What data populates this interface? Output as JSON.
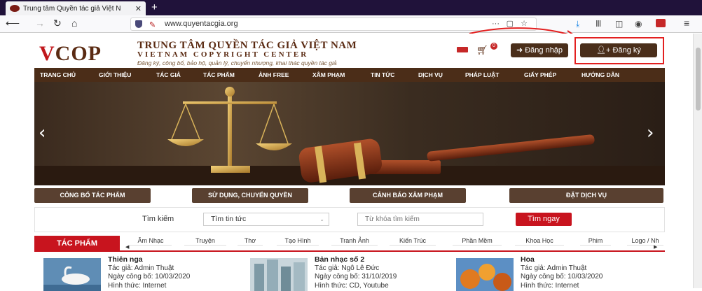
{
  "browser": {
    "tab_title": "Trung tâm Quyền tác giả Việt N",
    "url": "www.quyentacgia.org"
  },
  "header": {
    "logo_red": "V",
    "logo_rest": "COP",
    "org_name_vi": "TRUNG TÂM QUYỀN TÁC GIẢ VIỆT NAM",
    "org_name_en": "VIETNAM COPYRIGHT CENTER",
    "slogan": "Đăng ký, công bố, bảo hộ, quản lý, chuyển nhượng, khai thác quyền tác giả",
    "cart_count": "0",
    "login_label": "Đăng nhập",
    "register_label": "Đăng ký"
  },
  "menu": [
    "TRANG CHỦ",
    "GIỚI THIỆU",
    "TÁC GIẢ",
    "TÁC PHẨM",
    "ẢNH FREE",
    "XÂM PHẠM",
    "TIN TỨC",
    "DỊCH VỤ",
    "PHÁP LUẬT",
    "GIẤY PHÉP",
    "HƯỚNG DẪN"
  ],
  "services": [
    "CÔNG BỐ TÁC PHẨM",
    "SỬ DỤNG, CHUYỂN QUYỀN",
    "CẢNH BÁO XÂM PHẠM",
    "ĐẶT DỊCH VỤ"
  ],
  "search": {
    "label": "Tìm kiếm",
    "type_value": "Tìm tin tức",
    "placeholder": "Từ khóa tìm kiếm",
    "button": "Tìm ngay"
  },
  "works": {
    "title": "TÁC PHẨM",
    "tabs": [
      "Âm Nhạc",
      "Truyện",
      "Thơ",
      "Tạo Hình",
      "Tranh Ảnh",
      "Kiến Trúc",
      "Phần Mềm",
      "Khoa Học",
      "Phim",
      "Logo / Nh"
    ],
    "cards": [
      {
        "title": "Thiên nga",
        "author": "Tác giả: Admin Thuật",
        "date": "Ngày công bố: 10/03/2020",
        "form": "Hình thức: Internet"
      },
      {
        "title": "Bản nhạc số 2",
        "author": "Tác giả: Ngô Lê Đức",
        "date": "Ngày công bố: 31/10/2019",
        "form": "Hình thức: CD, Youtube"
      },
      {
        "title": "Hoa",
        "author": "Tác giả: Admin Thuật",
        "date": "Ngày công bố: 10/03/2020",
        "form": "Hình thức: Internet"
      }
    ]
  }
}
